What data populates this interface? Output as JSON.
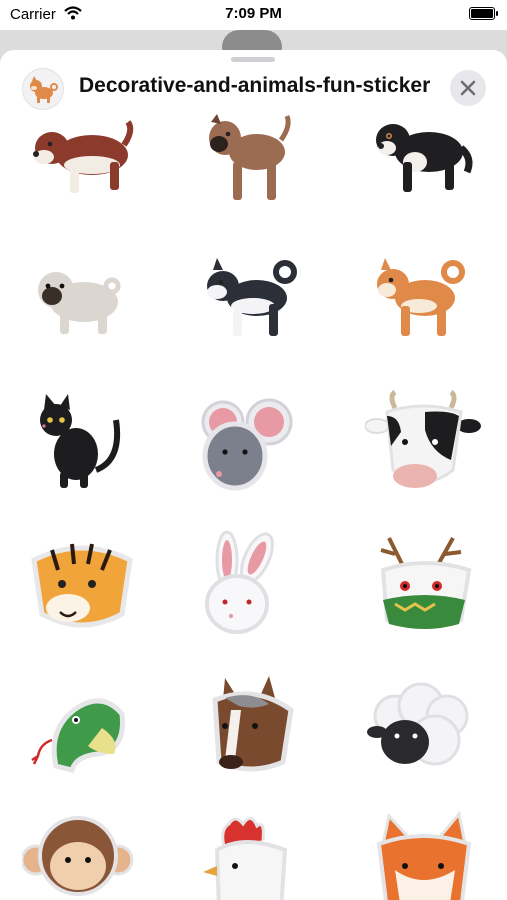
{
  "status_bar": {
    "carrier": "Carrier",
    "time": "7:09 PM"
  },
  "header": {
    "title": "Decorative-and-animals-fun-sticker",
    "icon": "shiba-dog-icon",
    "close_icon": "close-icon"
  },
  "stickers": [
    "beagle-dog",
    "boxer-dog",
    "bernese-dog",
    "pug-dog",
    "husky-dog",
    "shiba-dog",
    "black-cat",
    "mouse-head",
    "cow-head",
    "tiger-head",
    "rabbit-head",
    "dragon-head",
    "snake-head",
    "horse-head",
    "sheep-head",
    "monkey-head",
    "rooster-head",
    "fox-head"
  ],
  "colors": {
    "sheet_background": "#ffffff",
    "dimmed_background": "#9a9a9a",
    "close_button": "#e8e8ec",
    "title_text": "#111111"
  }
}
